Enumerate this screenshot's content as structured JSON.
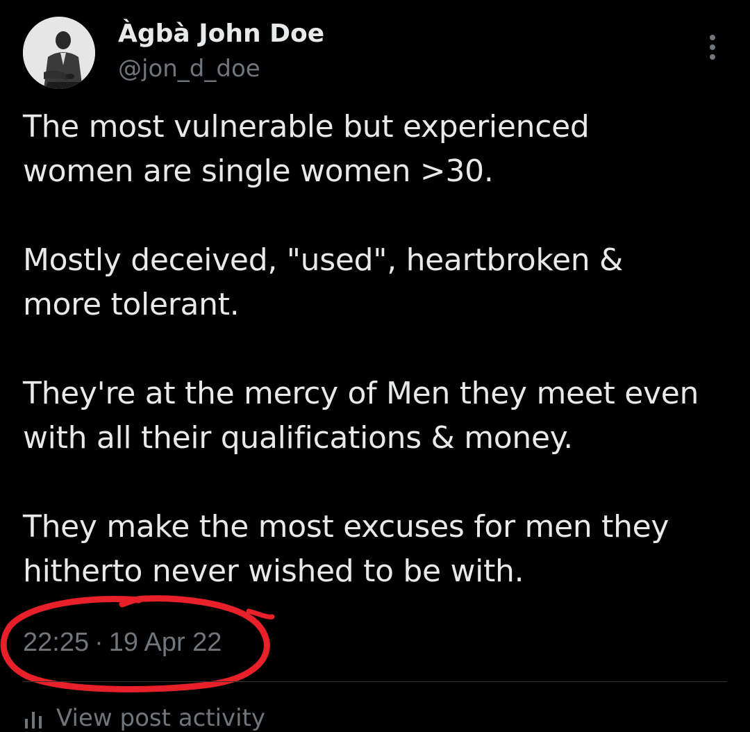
{
  "tweet": {
    "author": {
      "display_name": "Àgbà John Doe",
      "handle": "@jon_d_doe",
      "avatar_icon": "profile-photo-icon"
    },
    "more_icon": "more-options-icon",
    "paragraphs": [
      "The most vulnerable but experienced\nwomen are single women >30.",
      "Mostly deceived, \"used\", heartbroken &\nmore tolerant.",
      "They're at the mercy of Men they meet even\nwith all their qualifications & money.",
      "They make the most excuses for men they\nhitherto never wished to be with."
    ],
    "time": "22:25",
    "separator": "·",
    "date": "19 Apr 22",
    "analytics_label": "View post activity",
    "analytics_icon": "analytics-icon"
  },
  "colors": {
    "background": "#000000",
    "primary_text": "#e7e9ea",
    "secondary_text": "#71767b",
    "divider": "#2f3336",
    "annotation_circle": "#e8202a"
  }
}
